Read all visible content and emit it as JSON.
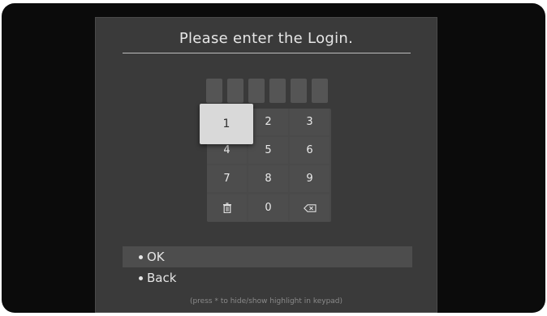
{
  "dialog": {
    "title": "Please enter the Login."
  },
  "code_slots": {
    "count": 6,
    "filled": 0
  },
  "keypad": {
    "keys": [
      "1",
      "2",
      "3",
      "4",
      "5",
      "6",
      "7",
      "8",
      "9",
      "delete-icon",
      "0",
      "backspace-icon"
    ],
    "focused_key": "1"
  },
  "menu": {
    "items": [
      {
        "label": "OK",
        "selected": true
      },
      {
        "label": "Back",
        "selected": false
      }
    ]
  },
  "hint": "(press * to hide/show highlight in keypad)"
}
